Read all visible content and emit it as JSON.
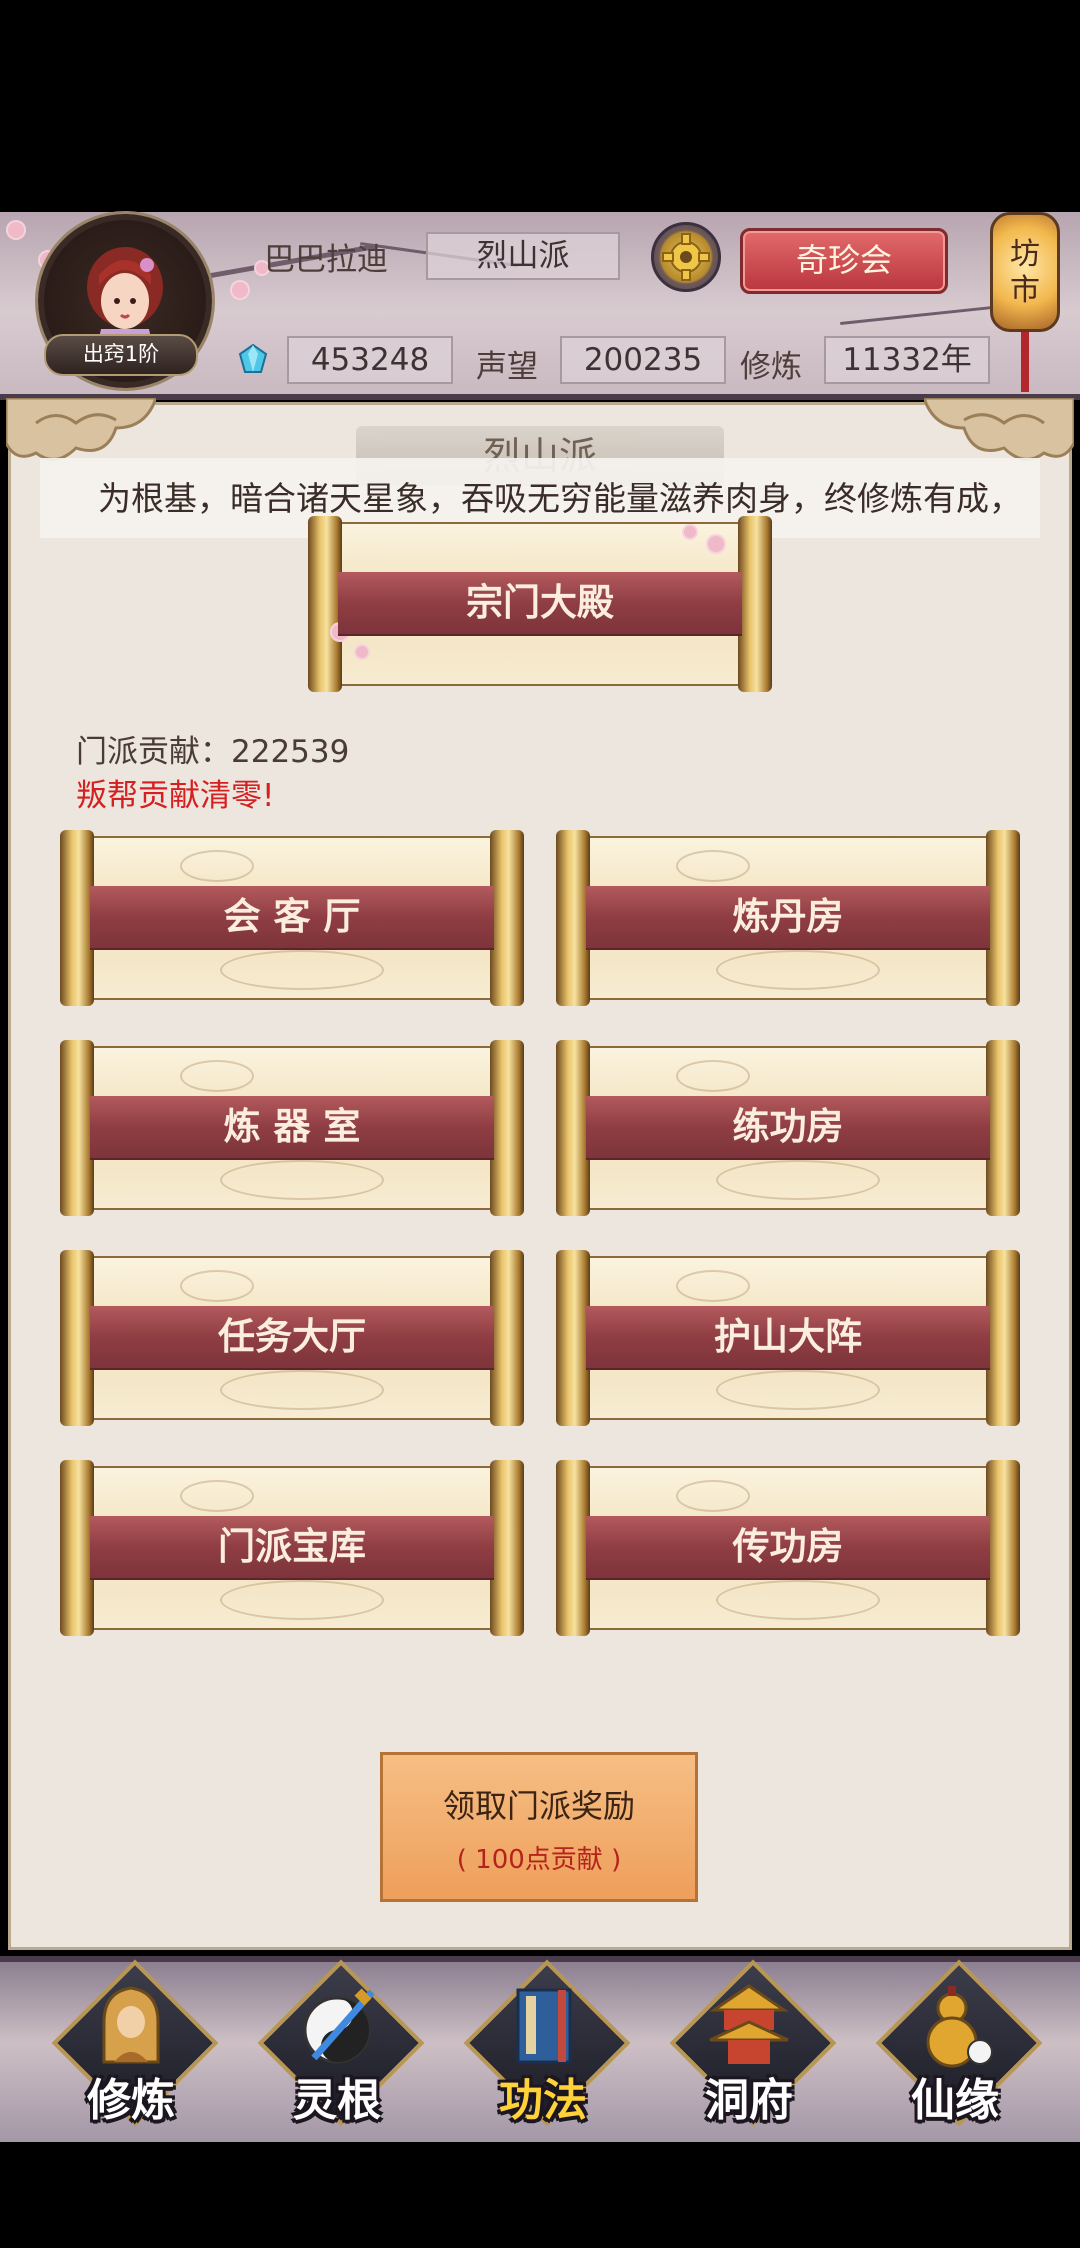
{
  "header": {
    "player_name": "巴巴拉迪",
    "sect_name": "烈山派",
    "rank": "出窍1阶",
    "spirit_stones": "453248",
    "prestige_label": "声望",
    "prestige_value": "200235",
    "cultivation_label": "修炼",
    "cultivation_value": "11332年",
    "treasure_button": "奇珍会",
    "market_button": "坊市"
  },
  "panel": {
    "title": "烈山派",
    "marquee": "为根基，暗合诸天星象，吞吸无穷能量滋养肉身，终修炼有成，",
    "main_hall": "宗门大殿",
    "contribution": "门派贡献：222539",
    "warning": "叛帮贡献清零!",
    "buildings": [
      "会 客 厅",
      "炼丹房",
      "炼 器 室",
      "练功房",
      "任务大厅",
      "护山大阵",
      "门派宝库",
      "传功房"
    ],
    "reward_title": "领取门派奖励",
    "reward_cost": "( 100点贡献 )"
  },
  "nav": {
    "items": [
      "修炼",
      "灵根",
      "功法",
      "洞府",
      "仙缘"
    ],
    "active_index": 2
  },
  "colors": {
    "accent_red": "#b9363e",
    "warning_red": "#d42020",
    "active_nav": "#ffd23a",
    "reward_orange": "#ee9f5b"
  }
}
